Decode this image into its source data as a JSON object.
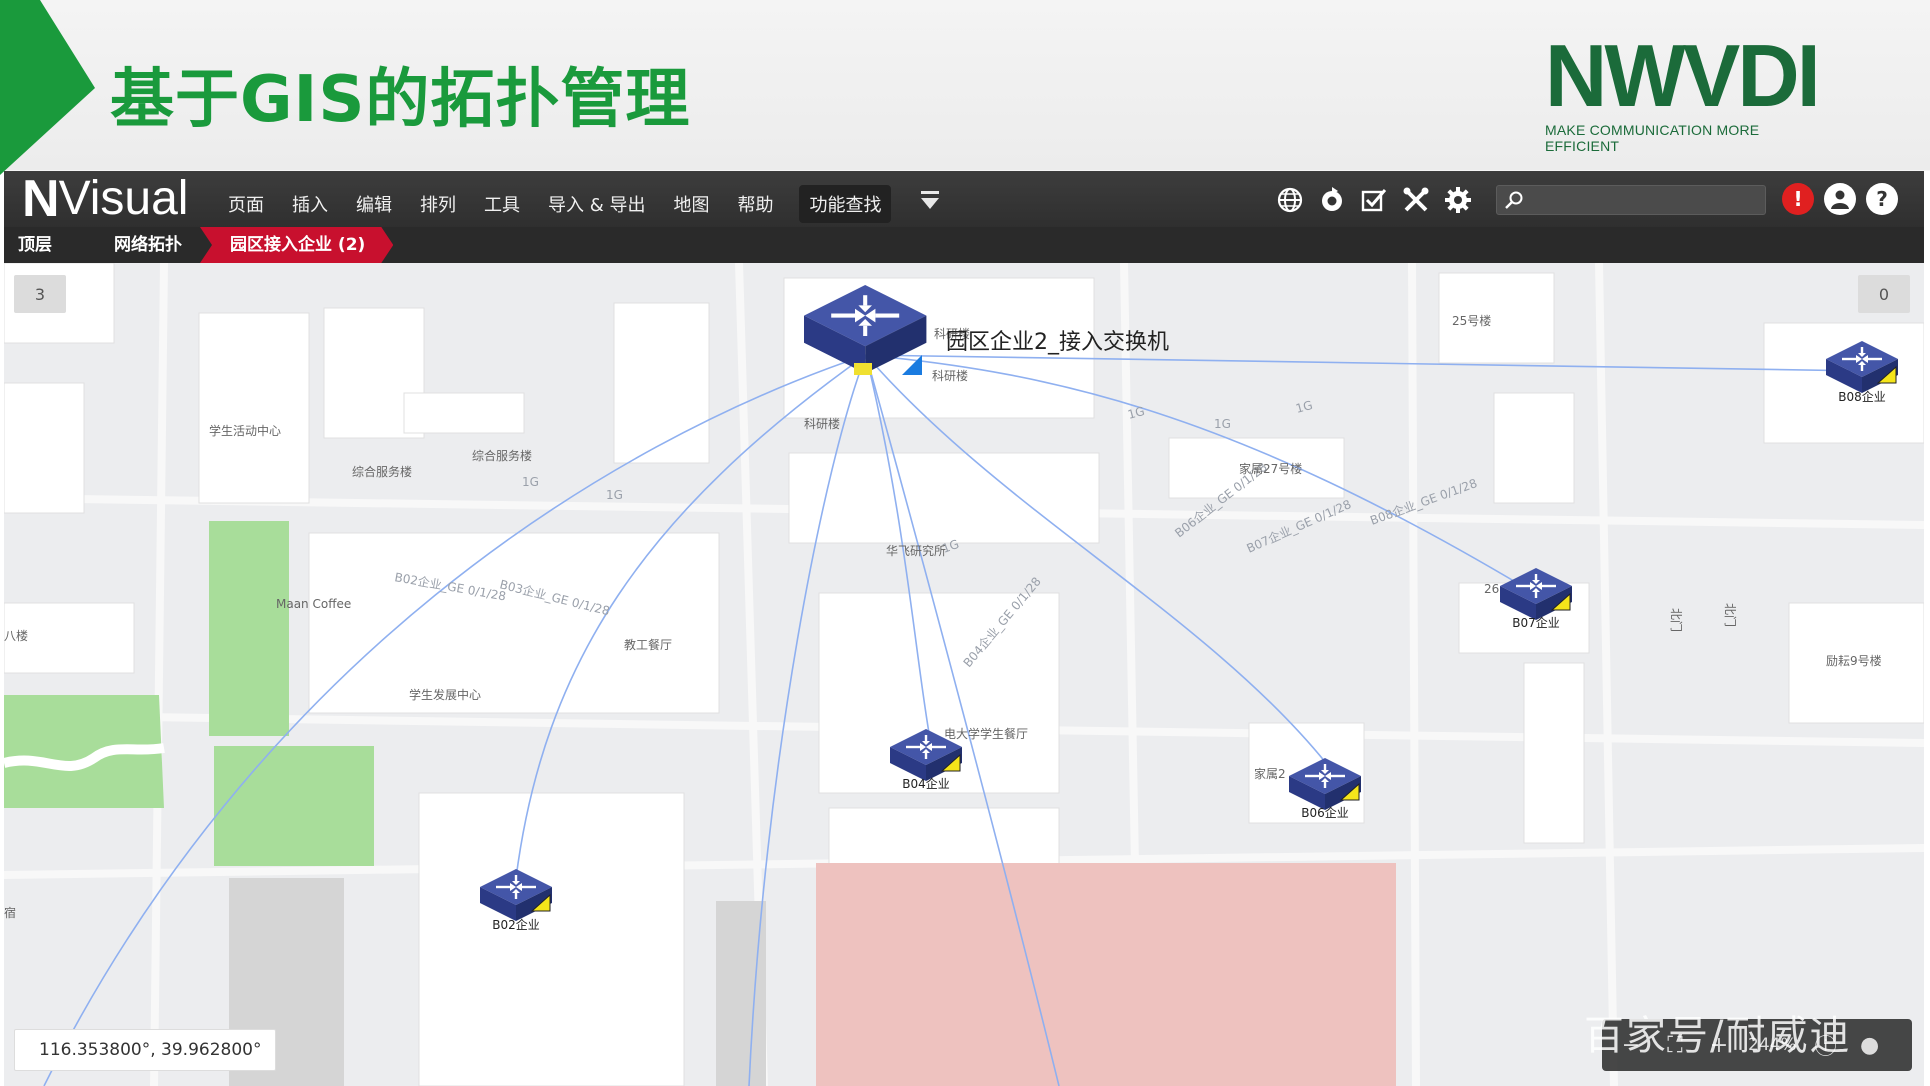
{
  "slide": {
    "title": "基于GIS的拓扑管理",
    "brand_name": "NWVDI",
    "brand_slogan": "MAKE COMMUNICATION MORE EFFICIENT",
    "accent_green": "#1a9a3c",
    "brand_green": "#1b6b3a"
  },
  "app": {
    "logo_n": "N",
    "logo_rest": "Visual",
    "menu": [
      "页面",
      "插入",
      "编辑",
      "排列",
      "工具",
      "导入 & 导出",
      "地图",
      "帮助"
    ],
    "function_search": "功能查找",
    "tool_icons": [
      "globe-icon",
      "refresh-icon",
      "checkbox-icon",
      "tools-icon",
      "gear-icon"
    ],
    "search_placeholder": "",
    "right_icons": [
      "alert-icon",
      "user-icon",
      "help-icon"
    ],
    "breadcrumb": [
      "顶层",
      "网络拓扑",
      "园区接入企业 (2)"
    ],
    "breadcrumb_active_color": "#c8102e"
  },
  "map": {
    "count_left": "3",
    "count_right": "0",
    "coordinates": "116.353800°, 39.962800°",
    "zoom_level": "244%",
    "watermark": "百家号/耐威迪",
    "main_switch": "园区企业2_接入交换机",
    "nodes": [
      "B08企业",
      "B07企业",
      "B04企业",
      "B06企业",
      "B02企业"
    ],
    "link_labels": [
      "1G",
      "1G",
      "1G",
      "1G",
      "1G",
      "1G",
      "1G",
      "B02企业_GE 0/1/28",
      "B03企业_GE 0/1/28",
      "B04企业_GE 0/1/28",
      "B06企业_GE 0/1/28",
      "B07企业_GE 0/1/28",
      "B08企业_GE 0/1/28"
    ],
    "place_labels": [
      "学生活动中心",
      "综合服务楼",
      "综合服务楼",
      "科研楼",
      "科研楼",
      "科研楼",
      "25号楼",
      "家属27号楼",
      "华飞研究所",
      "Maan Coffee",
      "教工餐厅",
      "学生发展中心",
      "电大学学生餐厅",
      "家属2",
      "26",
      "励耘9号楼",
      "北门",
      "北门",
      "八楼",
      "宿"
    ],
    "link_color": "#7aa0ee",
    "node_color": "#2f3f8f"
  }
}
